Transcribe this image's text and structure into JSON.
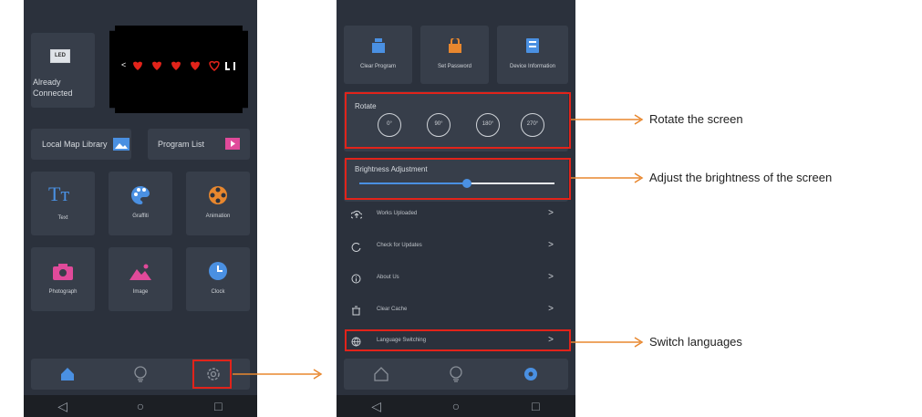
{
  "phone1": {
    "connected_label": "Already Connected",
    "led_icon_text": "LED",
    "preview_text": "<",
    "local_map_library": "Local Map Library",
    "program_list": "Program List",
    "tiles": [
      {
        "label": "Text",
        "icon": "text-icon"
      },
      {
        "label": "Graffiti",
        "icon": "palette-icon"
      },
      {
        "label": "Animation",
        "icon": "film-reel-icon"
      },
      {
        "label": "Photograph",
        "icon": "camera-icon"
      },
      {
        "label": "Image",
        "icon": "image-icon"
      },
      {
        "label": "Clock",
        "icon": "clock-icon"
      }
    ],
    "text_glyph": "Tт"
  },
  "phone2": {
    "top_buttons": [
      {
        "label": "Clear Program",
        "icon": "clear-program-icon"
      },
      {
        "label": "Set Password",
        "icon": "lock-icon"
      },
      {
        "label": "Device Information",
        "icon": "device-info-icon"
      }
    ],
    "rotate": {
      "title": "Rotate",
      "options": [
        "0°",
        "90°",
        "180°",
        "270°"
      ]
    },
    "brightness": {
      "title": "Brightness Adjustment",
      "level": 0.55
    },
    "menu": [
      {
        "label": "Works Uploaded",
        "icon": "upload-icon"
      },
      {
        "label": "Check for Updates",
        "icon": "refresh-icon"
      },
      {
        "label": "About Us",
        "icon": "info-icon"
      },
      {
        "label": "Clear Cache",
        "icon": "trash-icon"
      },
      {
        "label": "Language Switching",
        "icon": "globe-icon"
      }
    ],
    "chevron": ">"
  },
  "callouts": {
    "rotate": "Rotate the screen",
    "brightness": "Adjust the brightness of the screen",
    "language": "Switch languages"
  },
  "colors": {
    "background": "#2b313c",
    "tile": "#373e4a",
    "accent_blue": "#4a90e2",
    "highlight_red": "#e2231a",
    "arrow_orange": "#e8872e"
  }
}
